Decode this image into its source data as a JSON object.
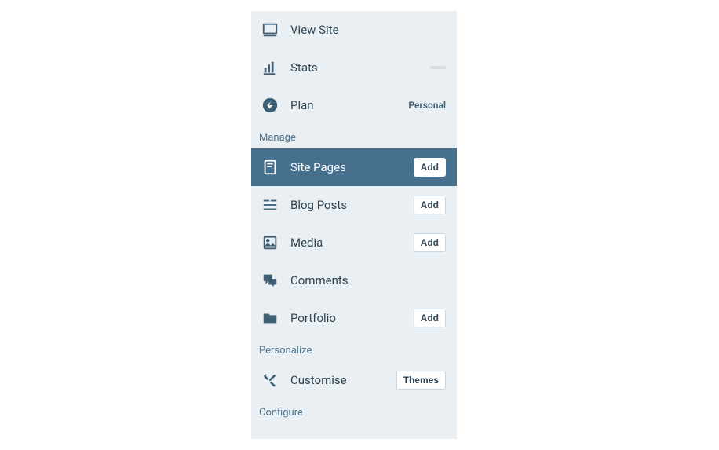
{
  "top": {
    "view_site": "View Site",
    "stats": "Stats",
    "plan": "Plan",
    "plan_badge": "Personal"
  },
  "sections": {
    "manage": "Manage",
    "personalize": "Personalize",
    "configure": "Configure"
  },
  "manage": {
    "site_pages": "Site Pages",
    "blog_posts": "Blog Posts",
    "media": "Media",
    "comments": "Comments",
    "portfolio": "Portfolio"
  },
  "personalize": {
    "customise": "Customise"
  },
  "buttons": {
    "add": "Add",
    "themes": "Themes"
  }
}
